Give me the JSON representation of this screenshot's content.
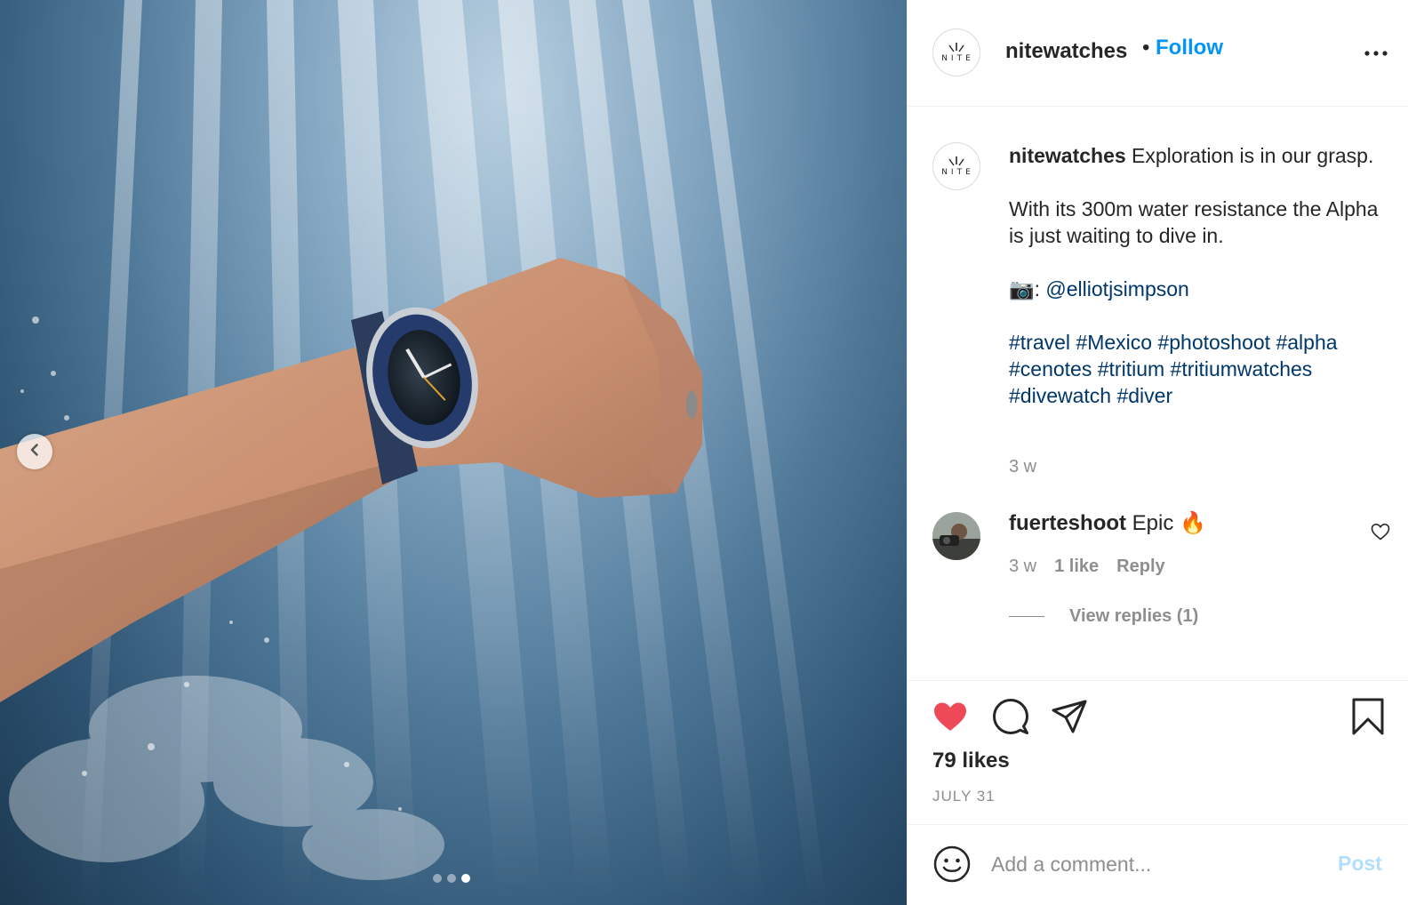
{
  "post": {
    "username": "nitewatches",
    "separator": "•",
    "follow_label": "Follow",
    "avatar_logo_text": "NITE",
    "more_icon": "more-horizontal-icon"
  },
  "caption": {
    "username": "nitewatches",
    "line1": " Exploration is in our grasp.",
    "line2": "With its 300m water resistance the Alpha is just waiting to dive in.",
    "camera_prefix": "📷: ",
    "mention": "@elliotjsimpson",
    "hashtags": "#travel #Mexico #photoshoot #alpha #cenotes #tritium #tritiumwatches #divewatch #diver",
    "time": "3 w"
  },
  "comments": [
    {
      "username": "fuerteshoot",
      "text": " Epic 🔥",
      "time": "3 w",
      "likes": "1 like",
      "reply_label": "Reply",
      "view_replies": "View replies (1)"
    }
  ],
  "actions": {
    "likes": "79 likes",
    "date": "JULY 31",
    "liked": true,
    "like_color": "#ed4956"
  },
  "add_comment": {
    "placeholder": "Add a comment...",
    "post_label": "Post"
  },
  "carousel": {
    "slides": 3,
    "active_index": 2
  }
}
